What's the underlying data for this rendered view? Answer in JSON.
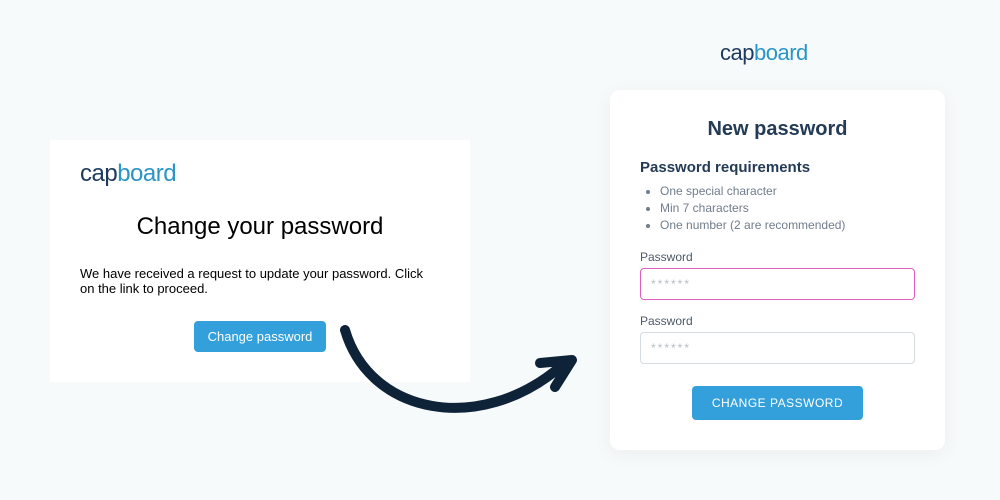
{
  "brand": {
    "part1": "cap",
    "part2": "board"
  },
  "email": {
    "title": "Change your password",
    "body": "We have received a request to update your password. Click on the link to proceed.",
    "button": "Change password"
  },
  "form": {
    "title": "New password",
    "req_title": "Password requirements",
    "reqs": [
      "One special character",
      "Min 7 characters",
      "One number (2 are recommended)"
    ],
    "field1_label": "Password",
    "field2_label": "Password",
    "placeholder": "******",
    "submit": "CHANGE PASSWORD"
  }
}
